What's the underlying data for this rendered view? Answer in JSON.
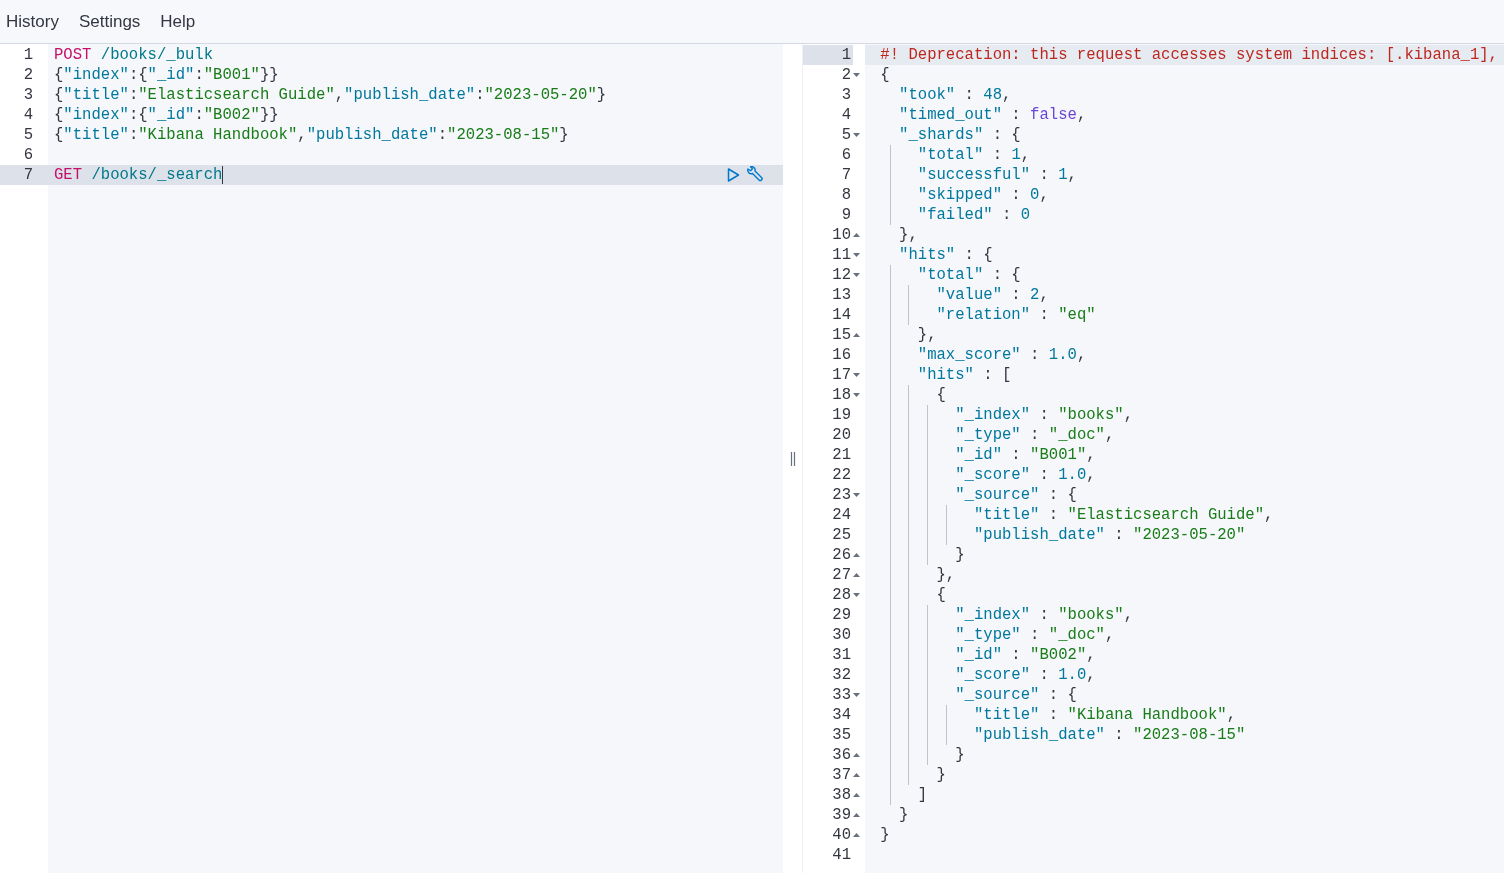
{
  "menu": [
    {
      "label": "History"
    },
    {
      "label": "Settings"
    },
    {
      "label": "Help"
    }
  ],
  "request_editor": {
    "lines": [
      {
        "number": "1",
        "selected": false,
        "tokens": [
          {
            "kind": "method",
            "text": "POST"
          },
          {
            "kind": "url",
            "text": " /books/_bulk"
          }
        ]
      },
      {
        "number": "2",
        "selected": false,
        "tokens": [
          {
            "kind": "punct",
            "text": "{"
          },
          {
            "kind": "key",
            "text": "\"index\""
          },
          {
            "kind": "punct",
            "text": ":{"
          },
          {
            "kind": "key",
            "text": "\"_id\""
          },
          {
            "kind": "punct",
            "text": ":"
          },
          {
            "kind": "string",
            "text": "\"B001\""
          },
          {
            "kind": "punct",
            "text": "}}"
          }
        ]
      },
      {
        "number": "3",
        "selected": false,
        "tokens": [
          {
            "kind": "punct",
            "text": "{"
          },
          {
            "kind": "key",
            "text": "\"title\""
          },
          {
            "kind": "punct",
            "text": ":"
          },
          {
            "kind": "string",
            "text": "\"Elasticsearch Guide\""
          },
          {
            "kind": "punct",
            "text": ","
          },
          {
            "kind": "key",
            "text": "\"publish_date\""
          },
          {
            "kind": "punct",
            "text": ":"
          },
          {
            "kind": "string",
            "text": "\"2023-05-20\""
          },
          {
            "kind": "punct",
            "text": "}"
          }
        ]
      },
      {
        "number": "4",
        "selected": false,
        "tokens": [
          {
            "kind": "punct",
            "text": "{"
          },
          {
            "kind": "key",
            "text": "\"index\""
          },
          {
            "kind": "punct",
            "text": ":{"
          },
          {
            "kind": "key",
            "text": "\"_id\""
          },
          {
            "kind": "punct",
            "text": ":"
          },
          {
            "kind": "string",
            "text": "\"B002\""
          },
          {
            "kind": "punct",
            "text": "}}"
          }
        ]
      },
      {
        "number": "5",
        "selected": false,
        "tokens": [
          {
            "kind": "punct",
            "text": "{"
          },
          {
            "kind": "key",
            "text": "\"title\""
          },
          {
            "kind": "punct",
            "text": ":"
          },
          {
            "kind": "string",
            "text": "\"Kibana Handbook\""
          },
          {
            "kind": "punct",
            "text": ","
          },
          {
            "kind": "key",
            "text": "\"publish_date\""
          },
          {
            "kind": "punct",
            "text": ":"
          },
          {
            "kind": "string",
            "text": "\"2023-08-15\""
          },
          {
            "kind": "punct",
            "text": "}"
          }
        ]
      },
      {
        "number": "6",
        "selected": false
      },
      {
        "number": "7",
        "selected": true,
        "tokens": [
          {
            "kind": "method",
            "text": "GET"
          },
          {
            "kind": "url",
            "text": " /books/_search"
          }
        ]
      }
    ]
  },
  "response_viewer": {
    "lines": [
      {
        "number": "1",
        "selected": true,
        "kind": "plain",
        "tokens": [
          {
            "kind": "comment",
            "text": "#! Deprecation: this request accesses system indices: [.kibana_1],"
          }
        ]
      },
      {
        "number": "2",
        "selected": false,
        "kind": "opener",
        "tokens": [
          {
            "kind": "punct",
            "text": "{"
          }
        ]
      },
      {
        "number": "3",
        "selected": false,
        "kind": "plain",
        "tokens": [
          {
            "kind": "key",
            "text": "  \"took\""
          },
          {
            "kind": "punct",
            "text": " : "
          },
          {
            "kind": "number",
            "text": "48"
          },
          {
            "kind": "punct",
            "text": ","
          }
        ]
      },
      {
        "number": "4",
        "selected": false,
        "kind": "plain",
        "tokens": [
          {
            "kind": "key",
            "text": "  \"timed_out\""
          },
          {
            "kind": "punct",
            "text": " : "
          },
          {
            "kind": "bool",
            "text": "false"
          },
          {
            "kind": "punct",
            "text": ","
          }
        ]
      },
      {
        "number": "5",
        "selected": false,
        "kind": "opener",
        "tokens": [
          {
            "kind": "key",
            "text": "  \"_shards\""
          },
          {
            "kind": "punct",
            "text": " : {"
          }
        ]
      },
      {
        "number": "6",
        "selected": false,
        "kind": "plain",
        "tokens": [
          {
            "kind": "key",
            "text": "    \"total\""
          },
          {
            "kind": "punct",
            "text": " : "
          },
          {
            "kind": "number",
            "text": "1"
          },
          {
            "kind": "punct",
            "text": ","
          }
        ]
      },
      {
        "number": "7",
        "selected": false,
        "kind": "plain",
        "tokens": [
          {
            "kind": "key",
            "text": "    \"successful\""
          },
          {
            "kind": "punct",
            "text": " : "
          },
          {
            "kind": "number",
            "text": "1"
          },
          {
            "kind": "punct",
            "text": ","
          }
        ]
      },
      {
        "number": "8",
        "selected": false,
        "kind": "plain",
        "tokens": [
          {
            "kind": "key",
            "text": "    \"skipped\""
          },
          {
            "kind": "punct",
            "text": " : "
          },
          {
            "kind": "number",
            "text": "0"
          },
          {
            "kind": "punct",
            "text": ","
          }
        ]
      },
      {
        "number": "9",
        "selected": false,
        "kind": "plain",
        "tokens": [
          {
            "kind": "key",
            "text": "    \"failed\""
          },
          {
            "kind": "punct",
            "text": " : "
          },
          {
            "kind": "number",
            "text": "0"
          }
        ]
      },
      {
        "number": "10",
        "selected": false,
        "kind": "closer",
        "tokens": [
          {
            "kind": "punct",
            "text": "  },"
          }
        ]
      },
      {
        "number": "11",
        "selected": false,
        "kind": "opener",
        "tokens": [
          {
            "kind": "key",
            "text": "  \"hits\""
          },
          {
            "kind": "punct",
            "text": " : {"
          }
        ]
      },
      {
        "number": "12",
        "selected": false,
        "kind": "opener",
        "tokens": [
          {
            "kind": "key",
            "text": "    \"total\""
          },
          {
            "kind": "punct",
            "text": " : {"
          }
        ]
      },
      {
        "number": "13",
        "selected": false,
        "kind": "plain",
        "tokens": [
          {
            "kind": "key",
            "text": "      \"value\""
          },
          {
            "kind": "punct",
            "text": " : "
          },
          {
            "kind": "number",
            "text": "2"
          },
          {
            "kind": "punct",
            "text": ","
          }
        ]
      },
      {
        "number": "14",
        "selected": false,
        "kind": "plain",
        "tokens": [
          {
            "kind": "key",
            "text": "      \"relation\""
          },
          {
            "kind": "punct",
            "text": " : "
          },
          {
            "kind": "string",
            "text": "\"eq\""
          }
        ]
      },
      {
        "number": "15",
        "selected": false,
        "kind": "closer",
        "tokens": [
          {
            "kind": "punct",
            "text": "    },"
          }
        ]
      },
      {
        "number": "16",
        "selected": false,
        "kind": "plain",
        "tokens": [
          {
            "kind": "key",
            "text": "    \"max_score\""
          },
          {
            "kind": "punct",
            "text": " : "
          },
          {
            "kind": "number",
            "text": "1.0"
          },
          {
            "kind": "punct",
            "text": ","
          }
        ]
      },
      {
        "number": "17",
        "selected": false,
        "kind": "opener",
        "tokens": [
          {
            "kind": "key",
            "text": "    \"hits\""
          },
          {
            "kind": "punct",
            "text": " : ["
          }
        ]
      },
      {
        "number": "18",
        "selected": false,
        "kind": "opener",
        "tokens": [
          {
            "kind": "punct",
            "text": "      {"
          }
        ]
      },
      {
        "number": "19",
        "selected": false,
        "kind": "plain",
        "tokens": [
          {
            "kind": "key",
            "text": "        \"_index\""
          },
          {
            "kind": "punct",
            "text": " : "
          },
          {
            "kind": "string",
            "text": "\"books\""
          },
          {
            "kind": "punct",
            "text": ","
          }
        ]
      },
      {
        "number": "20",
        "selected": false,
        "kind": "plain",
        "tokens": [
          {
            "kind": "key",
            "text": "        \"_type\""
          },
          {
            "kind": "punct",
            "text": " : "
          },
          {
            "kind": "string",
            "text": "\"_doc\""
          },
          {
            "kind": "punct",
            "text": ","
          }
        ]
      },
      {
        "number": "21",
        "selected": false,
        "kind": "plain",
        "tokens": [
          {
            "kind": "key",
            "text": "        \"_id\""
          },
          {
            "kind": "punct",
            "text": " : "
          },
          {
            "kind": "string",
            "text": "\"B001\""
          },
          {
            "kind": "punct",
            "text": ","
          }
        ]
      },
      {
        "number": "22",
        "selected": false,
        "kind": "plain",
        "tokens": [
          {
            "kind": "key",
            "text": "        \"_score\""
          },
          {
            "kind": "punct",
            "text": " : "
          },
          {
            "kind": "number",
            "text": "1.0"
          },
          {
            "kind": "punct",
            "text": ","
          }
        ]
      },
      {
        "number": "23",
        "selected": false,
        "kind": "opener",
        "tokens": [
          {
            "kind": "key",
            "text": "        \"_source\""
          },
          {
            "kind": "punct",
            "text": " : {"
          }
        ]
      },
      {
        "number": "24",
        "selected": false,
        "kind": "plain",
        "tokens": [
          {
            "kind": "key",
            "text": "          \"title\""
          },
          {
            "kind": "punct",
            "text": " : "
          },
          {
            "kind": "string",
            "text": "\"Elasticsearch Guide\""
          },
          {
            "kind": "punct",
            "text": ","
          }
        ]
      },
      {
        "number": "25",
        "selected": false,
        "kind": "plain",
        "tokens": [
          {
            "kind": "key",
            "text": "          \"publish_date\""
          },
          {
            "kind": "punct",
            "text": " : "
          },
          {
            "kind": "string",
            "text": "\"2023-05-20\""
          }
        ]
      },
      {
        "number": "26",
        "selected": false,
        "kind": "closer",
        "tokens": [
          {
            "kind": "punct",
            "text": "        }"
          }
        ]
      },
      {
        "number": "27",
        "selected": false,
        "kind": "closer",
        "tokens": [
          {
            "kind": "punct",
            "text": "      },"
          }
        ]
      },
      {
        "number": "28",
        "selected": false,
        "kind": "opener",
        "tokens": [
          {
            "kind": "punct",
            "text": "      {"
          }
        ]
      },
      {
        "number": "29",
        "selected": false,
        "kind": "plain",
        "tokens": [
          {
            "kind": "key",
            "text": "        \"_index\""
          },
          {
            "kind": "punct",
            "text": " : "
          },
          {
            "kind": "string",
            "text": "\"books\""
          },
          {
            "kind": "punct",
            "text": ","
          }
        ]
      },
      {
        "number": "30",
        "selected": false,
        "kind": "plain",
        "tokens": [
          {
            "kind": "key",
            "text": "        \"_type\""
          },
          {
            "kind": "punct",
            "text": " : "
          },
          {
            "kind": "string",
            "text": "\"_doc\""
          },
          {
            "kind": "punct",
            "text": ","
          }
        ]
      },
      {
        "number": "31",
        "selected": false,
        "kind": "plain",
        "tokens": [
          {
            "kind": "key",
            "text": "        \"_id\""
          },
          {
            "kind": "punct",
            "text": " : "
          },
          {
            "kind": "string",
            "text": "\"B002\""
          },
          {
            "kind": "punct",
            "text": ","
          }
        ]
      },
      {
        "number": "32",
        "selected": false,
        "kind": "plain",
        "tokens": [
          {
            "kind": "key",
            "text": "        \"_score\""
          },
          {
            "kind": "punct",
            "text": " : "
          },
          {
            "kind": "number",
            "text": "1.0"
          },
          {
            "kind": "punct",
            "text": ","
          }
        ]
      },
      {
        "number": "33",
        "selected": false,
        "kind": "opener",
        "tokens": [
          {
            "kind": "key",
            "text": "        \"_source\""
          },
          {
            "kind": "punct",
            "text": " : {"
          }
        ]
      },
      {
        "number": "34",
        "selected": false,
        "kind": "plain",
        "tokens": [
          {
            "kind": "key",
            "text": "          \"title\""
          },
          {
            "kind": "punct",
            "text": " : "
          },
          {
            "kind": "string",
            "text": "\"Kibana Handbook\""
          },
          {
            "kind": "punct",
            "text": ","
          }
        ]
      },
      {
        "number": "35",
        "selected": false,
        "kind": "plain",
        "tokens": [
          {
            "kind": "key",
            "text": "          \"publish_date\""
          },
          {
            "kind": "punct",
            "text": " : "
          },
          {
            "kind": "string",
            "text": "\"2023-08-15\""
          }
        ]
      },
      {
        "number": "36",
        "selected": false,
        "kind": "closer",
        "tokens": [
          {
            "kind": "punct",
            "text": "        }"
          }
        ]
      },
      {
        "number": "37",
        "selected": false,
        "kind": "closer",
        "tokens": [
          {
            "kind": "punct",
            "text": "      }"
          }
        ]
      },
      {
        "number": "38",
        "selected": false,
        "kind": "closer",
        "tokens": [
          {
            "kind": "punct",
            "text": "    ]"
          }
        ]
      },
      {
        "number": "39",
        "selected": false,
        "kind": "closer",
        "tokens": [
          {
            "kind": "punct",
            "text": "  }"
          }
        ]
      },
      {
        "number": "40",
        "selected": false,
        "kind": "closer",
        "tokens": [
          {
            "kind": "punct",
            "text": "}"
          }
        ]
      },
      {
        "number": "41",
        "selected": false,
        "kind": "plain"
      }
    ]
  }
}
